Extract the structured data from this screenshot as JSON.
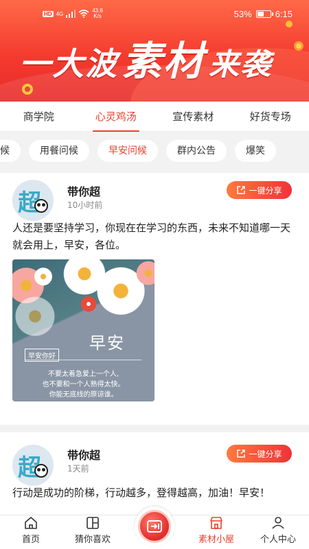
{
  "status_bar": {
    "network_badge": "HD",
    "signal_label": "4G",
    "speed_value": "43.8",
    "speed_unit": "K/s",
    "battery_percent": "53%",
    "time": "6:15",
    "battery_level": 0.53
  },
  "banner": {
    "title_part1": "一大波",
    "title_part2": "素材",
    "title_part3": "来袭"
  },
  "category_tabs": [
    {
      "label": "商学院",
      "active": false
    },
    {
      "label": "心灵鸡汤",
      "active": true
    },
    {
      "label": "宣传素材",
      "active": false
    },
    {
      "label": "好货专场",
      "active": false
    }
  ],
  "sub_tabs": [
    {
      "label": "问候",
      "active": false
    },
    {
      "label": "用餐问候",
      "active": false
    },
    {
      "label": "早安问候",
      "active": true
    },
    {
      "label": "群内公告",
      "active": false
    },
    {
      "label": "爆笑",
      "active": false
    }
  ],
  "posts": [
    {
      "author": "带你超",
      "time": "10小时前",
      "share_label": "一键分享",
      "text": "人还是要坚持学习，你现在在学习的东西，未来不知道哪一天就会用上，早安，各位。",
      "image": {
        "title": "早安",
        "subtitle": "早安你好",
        "poem_line1": "不要太着急爱上一个人,",
        "poem_line2": "也不要和一个人熟得太快。",
        "poem_line3": "你能无底线的原谅谁。"
      }
    },
    {
      "author": "带你超",
      "time": "1天前",
      "share_label": "一键分享",
      "text": "行动是成功的阶梯，行动越多，登得越高，加油！早安！"
    }
  ],
  "avatar_glyph": "超",
  "bottom_nav": [
    {
      "label": "首页",
      "icon": "home-icon",
      "active": false
    },
    {
      "label": "猜你喜欢",
      "icon": "guess-icon",
      "active": false
    },
    {
      "label": "",
      "icon": "publish-icon",
      "active": false
    },
    {
      "label": "素材小屋",
      "icon": "store-icon",
      "active": true
    },
    {
      "label": "个人中心",
      "icon": "user-icon",
      "active": false
    }
  ],
  "colors": {
    "accent": "#e8402c",
    "banner_top": "#ff6a47",
    "banner_bottom": "#e82a2a",
    "share_gradient_start": "#ff7a3d",
    "share_gradient_end": "#f0323a"
  }
}
